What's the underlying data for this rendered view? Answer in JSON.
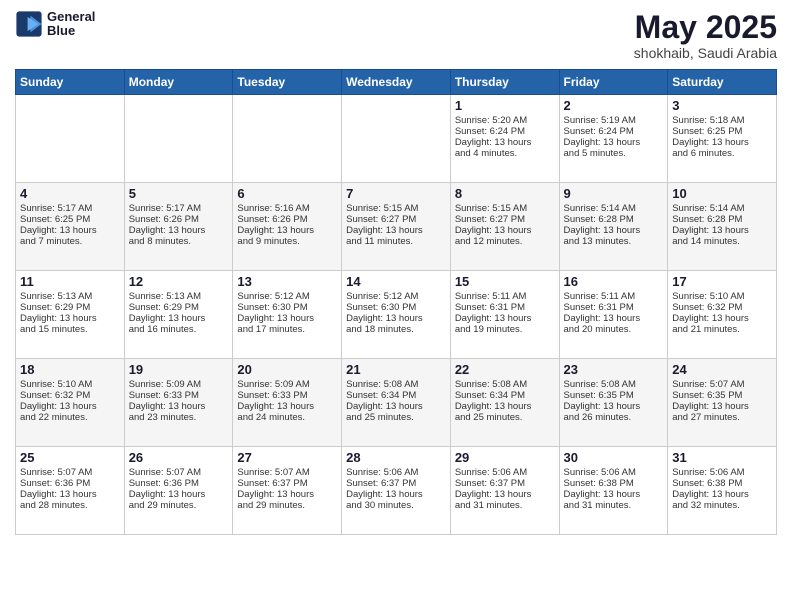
{
  "logo": {
    "line1": "General",
    "line2": "Blue"
  },
  "title": "May 2025",
  "subtitle": "shokhaib, Saudi Arabia",
  "weekdays": [
    "Sunday",
    "Monday",
    "Tuesday",
    "Wednesday",
    "Thursday",
    "Friday",
    "Saturday"
  ],
  "weeks": [
    [
      {
        "day": "",
        "content": ""
      },
      {
        "day": "",
        "content": ""
      },
      {
        "day": "",
        "content": ""
      },
      {
        "day": "",
        "content": ""
      },
      {
        "day": "1",
        "content": "Sunrise: 5:20 AM\nSunset: 6:24 PM\nDaylight: 13 hours\nand 4 minutes."
      },
      {
        "day": "2",
        "content": "Sunrise: 5:19 AM\nSunset: 6:24 PM\nDaylight: 13 hours\nand 5 minutes."
      },
      {
        "day": "3",
        "content": "Sunrise: 5:18 AM\nSunset: 6:25 PM\nDaylight: 13 hours\nand 6 minutes."
      }
    ],
    [
      {
        "day": "4",
        "content": "Sunrise: 5:17 AM\nSunset: 6:25 PM\nDaylight: 13 hours\nand 7 minutes."
      },
      {
        "day": "5",
        "content": "Sunrise: 5:17 AM\nSunset: 6:26 PM\nDaylight: 13 hours\nand 8 minutes."
      },
      {
        "day": "6",
        "content": "Sunrise: 5:16 AM\nSunset: 6:26 PM\nDaylight: 13 hours\nand 9 minutes."
      },
      {
        "day": "7",
        "content": "Sunrise: 5:15 AM\nSunset: 6:27 PM\nDaylight: 13 hours\nand 11 minutes."
      },
      {
        "day": "8",
        "content": "Sunrise: 5:15 AM\nSunset: 6:27 PM\nDaylight: 13 hours\nand 12 minutes."
      },
      {
        "day": "9",
        "content": "Sunrise: 5:14 AM\nSunset: 6:28 PM\nDaylight: 13 hours\nand 13 minutes."
      },
      {
        "day": "10",
        "content": "Sunrise: 5:14 AM\nSunset: 6:28 PM\nDaylight: 13 hours\nand 14 minutes."
      }
    ],
    [
      {
        "day": "11",
        "content": "Sunrise: 5:13 AM\nSunset: 6:29 PM\nDaylight: 13 hours\nand 15 minutes."
      },
      {
        "day": "12",
        "content": "Sunrise: 5:13 AM\nSunset: 6:29 PM\nDaylight: 13 hours\nand 16 minutes."
      },
      {
        "day": "13",
        "content": "Sunrise: 5:12 AM\nSunset: 6:30 PM\nDaylight: 13 hours\nand 17 minutes."
      },
      {
        "day": "14",
        "content": "Sunrise: 5:12 AM\nSunset: 6:30 PM\nDaylight: 13 hours\nand 18 minutes."
      },
      {
        "day": "15",
        "content": "Sunrise: 5:11 AM\nSunset: 6:31 PM\nDaylight: 13 hours\nand 19 minutes."
      },
      {
        "day": "16",
        "content": "Sunrise: 5:11 AM\nSunset: 6:31 PM\nDaylight: 13 hours\nand 20 minutes."
      },
      {
        "day": "17",
        "content": "Sunrise: 5:10 AM\nSunset: 6:32 PM\nDaylight: 13 hours\nand 21 minutes."
      }
    ],
    [
      {
        "day": "18",
        "content": "Sunrise: 5:10 AM\nSunset: 6:32 PM\nDaylight: 13 hours\nand 22 minutes."
      },
      {
        "day": "19",
        "content": "Sunrise: 5:09 AM\nSunset: 6:33 PM\nDaylight: 13 hours\nand 23 minutes."
      },
      {
        "day": "20",
        "content": "Sunrise: 5:09 AM\nSunset: 6:33 PM\nDaylight: 13 hours\nand 24 minutes."
      },
      {
        "day": "21",
        "content": "Sunrise: 5:08 AM\nSunset: 6:34 PM\nDaylight: 13 hours\nand 25 minutes."
      },
      {
        "day": "22",
        "content": "Sunrise: 5:08 AM\nSunset: 6:34 PM\nDaylight: 13 hours\nand 25 minutes."
      },
      {
        "day": "23",
        "content": "Sunrise: 5:08 AM\nSunset: 6:35 PM\nDaylight: 13 hours\nand 26 minutes."
      },
      {
        "day": "24",
        "content": "Sunrise: 5:07 AM\nSunset: 6:35 PM\nDaylight: 13 hours\nand 27 minutes."
      }
    ],
    [
      {
        "day": "25",
        "content": "Sunrise: 5:07 AM\nSunset: 6:36 PM\nDaylight: 13 hours\nand 28 minutes."
      },
      {
        "day": "26",
        "content": "Sunrise: 5:07 AM\nSunset: 6:36 PM\nDaylight: 13 hours\nand 29 minutes."
      },
      {
        "day": "27",
        "content": "Sunrise: 5:07 AM\nSunset: 6:37 PM\nDaylight: 13 hours\nand 29 minutes."
      },
      {
        "day": "28",
        "content": "Sunrise: 5:06 AM\nSunset: 6:37 PM\nDaylight: 13 hours\nand 30 minutes."
      },
      {
        "day": "29",
        "content": "Sunrise: 5:06 AM\nSunset: 6:37 PM\nDaylight: 13 hours\nand 31 minutes."
      },
      {
        "day": "30",
        "content": "Sunrise: 5:06 AM\nSunset: 6:38 PM\nDaylight: 13 hours\nand 31 minutes."
      },
      {
        "day": "31",
        "content": "Sunrise: 5:06 AM\nSunset: 6:38 PM\nDaylight: 13 hours\nand 32 minutes."
      }
    ]
  ]
}
